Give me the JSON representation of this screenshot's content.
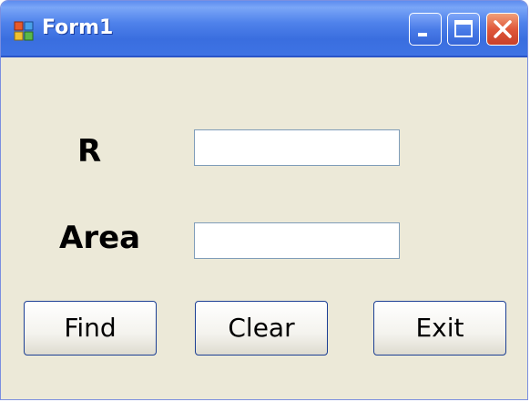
{
  "window": {
    "title": "Form1"
  },
  "form": {
    "r_label": "R",
    "area_label": "Area",
    "r_value": "",
    "area_value": ""
  },
  "buttons": {
    "find": "Find",
    "clear": "Clear",
    "exit": "Exit"
  },
  "icons": {
    "app": "form-app-icon",
    "minimize": "minimize-icon",
    "maximize": "maximize-icon",
    "close": "close-icon"
  },
  "colors": {
    "titlebar": "#3a6edf",
    "client_background": "#ece9d8",
    "close_button": "#e0583a"
  }
}
